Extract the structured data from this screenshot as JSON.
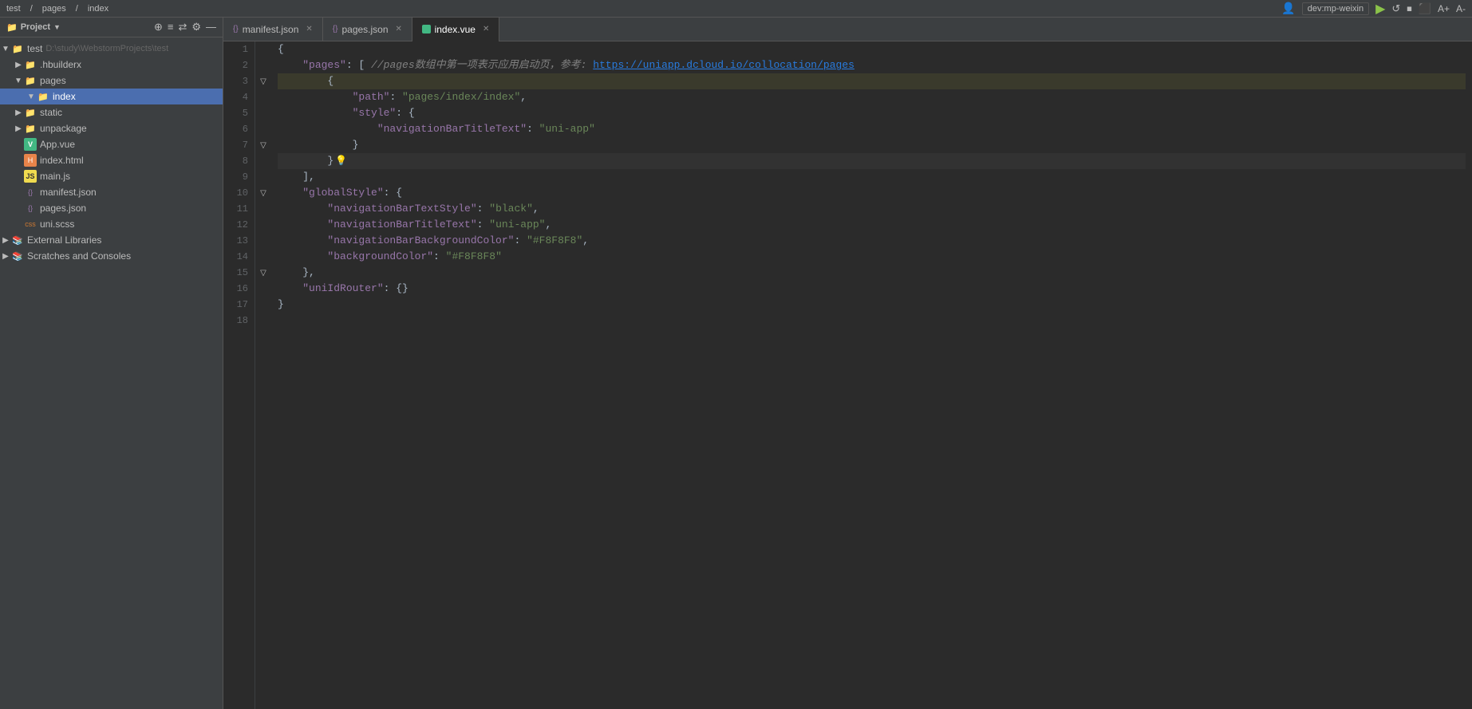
{
  "topbar": {
    "menu_items": [
      "test",
      "pages",
      "index"
    ],
    "device_selector": "dev:mp-weixin",
    "run_btn": "▶",
    "icons": [
      "↺",
      "⟳",
      "⏹",
      "⬛",
      "A+",
      "A-"
    ]
  },
  "sidebar": {
    "title": "Project",
    "icons": [
      "⊕",
      "≡",
      "⇄",
      "⚙",
      "—"
    ],
    "tree": [
      {
        "id": "test",
        "label": "test",
        "path": "D:\\study\\WebstormProjects\\test",
        "type": "root",
        "indent": 0,
        "expanded": true
      },
      {
        "id": "hbuilderx",
        "label": ".hbuilderx",
        "type": "folder",
        "indent": 1,
        "expanded": false
      },
      {
        "id": "pages",
        "label": "pages",
        "type": "folder",
        "indent": 1,
        "expanded": true
      },
      {
        "id": "index",
        "label": "index",
        "type": "folder",
        "indent": 2,
        "expanded": true,
        "selected": true
      },
      {
        "id": "static",
        "label": "static",
        "type": "folder",
        "indent": 1,
        "expanded": false
      },
      {
        "id": "unpackage",
        "label": "unpackage",
        "type": "folder",
        "indent": 1,
        "expanded": false
      },
      {
        "id": "App.vue",
        "label": "App.vue",
        "type": "vue",
        "indent": 1,
        "expanded": false
      },
      {
        "id": "index.html",
        "label": "index.html",
        "type": "html",
        "indent": 1,
        "expanded": false
      },
      {
        "id": "main.js",
        "label": "main.js",
        "type": "js",
        "indent": 1,
        "expanded": false
      },
      {
        "id": "manifest.json",
        "label": "manifest.json",
        "type": "json",
        "indent": 1,
        "expanded": false
      },
      {
        "id": "pages.json",
        "label": "pages.json",
        "type": "json",
        "indent": 1,
        "expanded": false
      },
      {
        "id": "uni.scss",
        "label": "uni.scss",
        "type": "css",
        "indent": 1,
        "expanded": false
      },
      {
        "id": "external",
        "label": "External Libraries",
        "type": "folder-special",
        "indent": 0,
        "expanded": false
      },
      {
        "id": "scratches",
        "label": "Scratches and Consoles",
        "type": "folder-special",
        "indent": 0,
        "expanded": false
      }
    ]
  },
  "tabs": [
    {
      "id": "manifest",
      "label": "manifest.json",
      "icon": "json",
      "active": false,
      "closable": true
    },
    {
      "id": "pages",
      "label": "pages.json",
      "icon": "json",
      "active": false,
      "closable": true
    },
    {
      "id": "index",
      "label": "index.vue",
      "icon": "vue",
      "active": true,
      "closable": true
    }
  ],
  "breadcrumb": [
    "pages",
    "index"
  ],
  "editor": {
    "filename": "pages.json",
    "lines": [
      {
        "num": 1,
        "content": "{",
        "tokens": [
          {
            "text": "{",
            "class": "c-brace"
          }
        ]
      },
      {
        "num": 2,
        "content": "    \"pages\": [ //pages数组中第一项表示应用启动页，参考: https://uniapp.dcloud.io/collocation/pages",
        "tokens": [
          {
            "text": "    ",
            "class": ""
          },
          {
            "text": "\"pages\"",
            "class": "c-key"
          },
          {
            "text": ": [ ",
            "class": "c-brace"
          },
          {
            "text": "//pages数组中第一项表示应用启动页，参考: ",
            "class": "c-comment"
          },
          {
            "text": "https://uniapp.dcloud.io/collocation/pages",
            "class": "c-link"
          }
        ]
      },
      {
        "num": 3,
        "content": "        {",
        "tokens": [
          {
            "text": "        {",
            "class": "c-brace"
          }
        ],
        "highlight": true
      },
      {
        "num": 4,
        "content": "            \"path\": \"pages/index/index\",",
        "tokens": [
          {
            "text": "            ",
            "class": ""
          },
          {
            "text": "\"path\"",
            "class": "c-key"
          },
          {
            "text": ": ",
            "class": "c-colon"
          },
          {
            "text": "\"pages/index/index\"",
            "class": "c-string"
          },
          {
            "text": ",",
            "class": "c-brace"
          }
        ]
      },
      {
        "num": 5,
        "content": "            \"style\": {",
        "tokens": [
          {
            "text": "            ",
            "class": ""
          },
          {
            "text": "\"style\"",
            "class": "c-key"
          },
          {
            "text": ": {",
            "class": "c-brace"
          }
        ]
      },
      {
        "num": 6,
        "content": "                \"navigationBarTitleText\": \"uni-app\"",
        "tokens": [
          {
            "text": "                ",
            "class": ""
          },
          {
            "text": "\"navigationBarTitleText\"",
            "class": "c-key"
          },
          {
            "text": ": ",
            "class": "c-colon"
          },
          {
            "text": "\"uni-app\"",
            "class": "c-string"
          }
        ]
      },
      {
        "num": 7,
        "content": "            }",
        "tokens": [
          {
            "text": "            }",
            "class": "c-brace"
          }
        ]
      },
      {
        "num": 8,
        "content": "        }",
        "tokens": [
          {
            "text": "        }",
            "class": "c-brace"
          }
        ],
        "hint": true,
        "light_highlight": true
      },
      {
        "num": 9,
        "content": "    ],",
        "tokens": [
          {
            "text": "    ],",
            "class": "c-brace"
          }
        ]
      },
      {
        "num": 10,
        "content": "    \"globalStyle\": {",
        "tokens": [
          {
            "text": "    ",
            "class": ""
          },
          {
            "text": "\"globalStyle\"",
            "class": "c-key"
          },
          {
            "text": ": {",
            "class": "c-brace"
          }
        ]
      },
      {
        "num": 11,
        "content": "        \"navigationBarTextStyle\": \"black\",",
        "tokens": [
          {
            "text": "        ",
            "class": ""
          },
          {
            "text": "\"navigationBarTextStyle\"",
            "class": "c-key"
          },
          {
            "text": ": ",
            "class": "c-colon"
          },
          {
            "text": "\"black\"",
            "class": "c-string"
          },
          {
            "text": ",",
            "class": "c-brace"
          }
        ]
      },
      {
        "num": 12,
        "content": "        \"navigationBarTitleText\": \"uni-app\",",
        "tokens": [
          {
            "text": "        ",
            "class": ""
          },
          {
            "text": "\"navigationBarTitleText\"",
            "class": "c-key"
          },
          {
            "text": ": ",
            "class": "c-colon"
          },
          {
            "text": "\"uni-app\"",
            "class": "c-string"
          },
          {
            "text": ",",
            "class": "c-brace"
          }
        ]
      },
      {
        "num": 13,
        "content": "        \"navigationBarBackgroundColor\": \"#F8F8F8\",",
        "tokens": [
          {
            "text": "        ",
            "class": ""
          },
          {
            "text": "\"navigationBarBackgroundColor\"",
            "class": "c-key"
          },
          {
            "text": ": ",
            "class": "c-colon"
          },
          {
            "text": "\"#F8F8F8\"",
            "class": "c-string"
          },
          {
            "text": ",",
            "class": "c-brace"
          }
        ]
      },
      {
        "num": 14,
        "content": "        \"backgroundColor\": \"#F8F8F8\"",
        "tokens": [
          {
            "text": "        ",
            "class": ""
          },
          {
            "text": "\"backgroundColor\"",
            "class": "c-key"
          },
          {
            "text": ": ",
            "class": "c-colon"
          },
          {
            "text": "\"#F8F8F8\"",
            "class": "c-string"
          }
        ]
      },
      {
        "num": 15,
        "content": "    },",
        "tokens": [
          {
            "text": "    },",
            "class": "c-brace"
          }
        ]
      },
      {
        "num": 16,
        "content": "    \"uniIdRouter\": {}",
        "tokens": [
          {
            "text": "    ",
            "class": ""
          },
          {
            "text": "\"uniIdRouter\"",
            "class": "c-key"
          },
          {
            "text": ": {}",
            "class": "c-brace"
          }
        ]
      },
      {
        "num": 17,
        "content": "}",
        "tokens": [
          {
            "text": "}",
            "class": "c-brace"
          }
        ]
      },
      {
        "num": 18,
        "content": "",
        "tokens": []
      }
    ]
  }
}
